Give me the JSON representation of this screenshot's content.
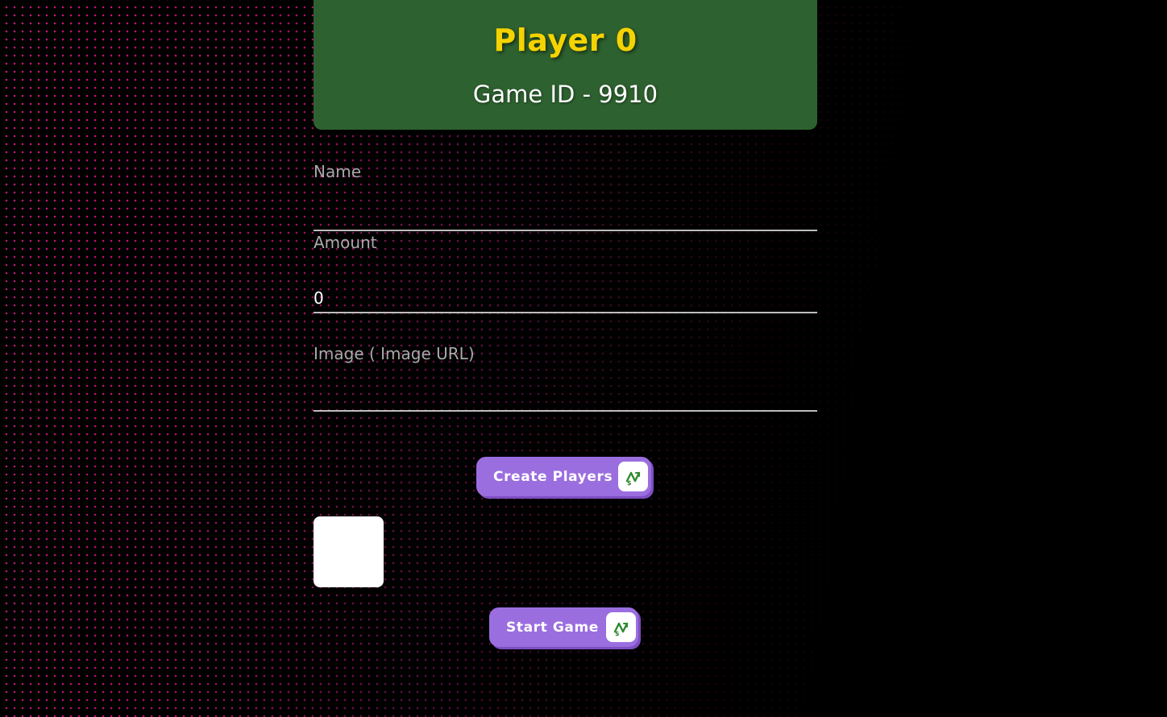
{
  "header": {
    "player_title": "Player 0",
    "game_id": "Game ID - 9910"
  },
  "form": {
    "name": {
      "label": "Name",
      "value": ""
    },
    "amount": {
      "label": "Amount",
      "value": "0"
    },
    "image": {
      "label": "Image ( Image URL)",
      "value": ""
    }
  },
  "buttons": {
    "create_players": {
      "label": "Create Players",
      "icon": "dollar-arrow-icon"
    },
    "start_game": {
      "label": "Start Game",
      "icon": "dollar-arrow-icon"
    }
  },
  "colors": {
    "header_bg": "#2e6130",
    "title": "#f5d300",
    "button": "#9b6ee0",
    "icon": "#2e8b2e",
    "dots": "#c4177e"
  }
}
